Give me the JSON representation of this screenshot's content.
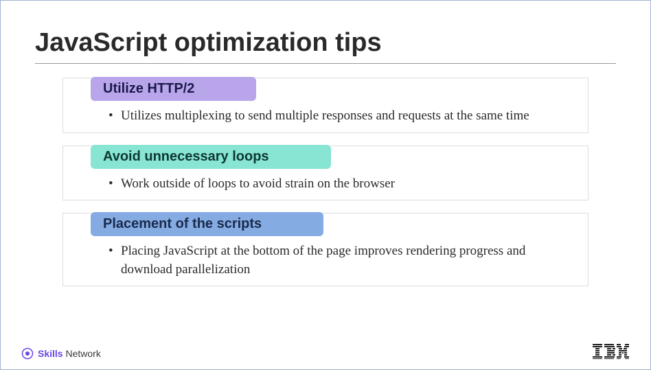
{
  "title": "JavaScript optimization tips",
  "tips": [
    {
      "heading": "Utilize HTTP/2",
      "color": "purple",
      "bullets": [
        "Utilizes multiplexing to send multiple responses and requests at the same time"
      ]
    },
    {
      "heading": "Avoid unnecessary loops",
      "color": "teal",
      "bullets": [
        "Work outside of loops to avoid strain on the browser"
      ]
    },
    {
      "heading": "Placement of the scripts",
      "color": "blue",
      "bullets": [
        "Placing JavaScript at the bottom of the page improves rendering progress and download parallelization"
      ]
    }
  ],
  "footer": {
    "skills_bold": "Skills",
    "skills_rest": "Network",
    "ibm": "IBM"
  }
}
